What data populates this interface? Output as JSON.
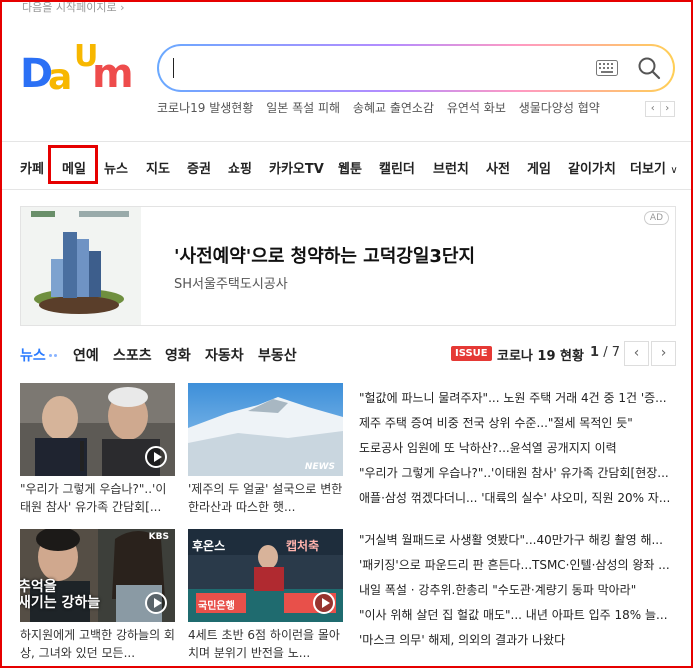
{
  "header": {
    "set_home": "다음을 시작페이지로 ›"
  },
  "logo": {
    "letters": [
      "D",
      "a",
      "U",
      "m"
    ],
    "colors": [
      "#2b70f5",
      "#f7b700",
      "#ee4c4c",
      "#ff8a7a"
    ]
  },
  "search": {
    "value": "",
    "placeholder": ""
  },
  "icons": {
    "keyboard": "keyboard-icon",
    "search": "search-icon"
  },
  "trends": {
    "items": [
      "코로나19 발생현황",
      "일본 폭설 피해",
      "송혜교 출연소감",
      "유연석 화보",
      "생물다양성 협약"
    ],
    "prev": "‹",
    "next": "›"
  },
  "gnb": {
    "items": [
      "카페",
      "메일",
      "뉴스",
      "지도",
      "증권",
      "쇼핑",
      "카카오TV",
      "웹툰",
      "캘린더",
      "브런치",
      "사전",
      "게임",
      "같이가치",
      "더보기"
    ],
    "more_arrow": "∨"
  },
  "ad": {
    "title": "'사전예약'으로 청약하는 고덕강일3단지",
    "sub": "SH서울주택도시공사",
    "badge": "AD"
  },
  "tabs": {
    "items": [
      "뉴스",
      "연예",
      "스포츠",
      "영화",
      "자동차",
      "부동산"
    ]
  },
  "issue": {
    "badge": "ISSUE",
    "text": "코로나 19 현황",
    "page_current": "1",
    "page_total": "/ 7",
    "prev": "‹",
    "next": "›"
  },
  "cards": [
    {
      "caption": "\"우리가 그렇게 우습나?\"..'이태원 참사' 유가족 간담회[..."
    },
    {
      "caption": "'제주의 두 얼굴' 설국으로 변한 한라산과 따스한 햇..."
    },
    {
      "caption": "하지원에게 고백한 강하늘의 회상, 그녀와 있던 모든..."
    },
    {
      "caption": "4세트 초반 6점 하이런을 몰아치며 분위기 반전을 노..."
    }
  ],
  "thumb_text": {
    "news_label": "NEWS",
    "kbs": "KBS",
    "drama_line1": "추억을",
    "drama_line2": "새기는 강하늘",
    "bank1": "후온스",
    "bank2": "국민은행",
    "bank3": "캡처축"
  },
  "headlines": [
    "\"헐값에 파느니 물려주자\"... 노원 주택 거래 4건 중 1건 '증...",
    "제주 주택 증여 비중 전국 상위 수준...\"절세 목적인 듯\"",
    "도로공사 임원에 또 낙하산?...윤석열 공개지지 이력",
    "\"우리가 그렇게 우습나?\"..'이태원 참사' 유가족 간담회[현장...",
    "애플·삼성 꺾겠다더니... '대륙의 실수' 샤오미, 직원 20% 자...",
    "\"거실벽 월패드로 사생활 엿봤다\"...40만가구 해킹 촬영 해...",
    "'패키징'으로 파운드리 판 흔든다...TSMC·인텔·삼성의 왕좌 ...",
    "내일 폭설 · 강추위.한총리 \"수도관·계량기 동파 막아라\"",
    "\"이사 위해 살던 집 헐값 매도\"... 내년 아파트 입주 18% 늘...",
    "'마스크 의무' 해제, 의외의 결과가 나왔다"
  ]
}
